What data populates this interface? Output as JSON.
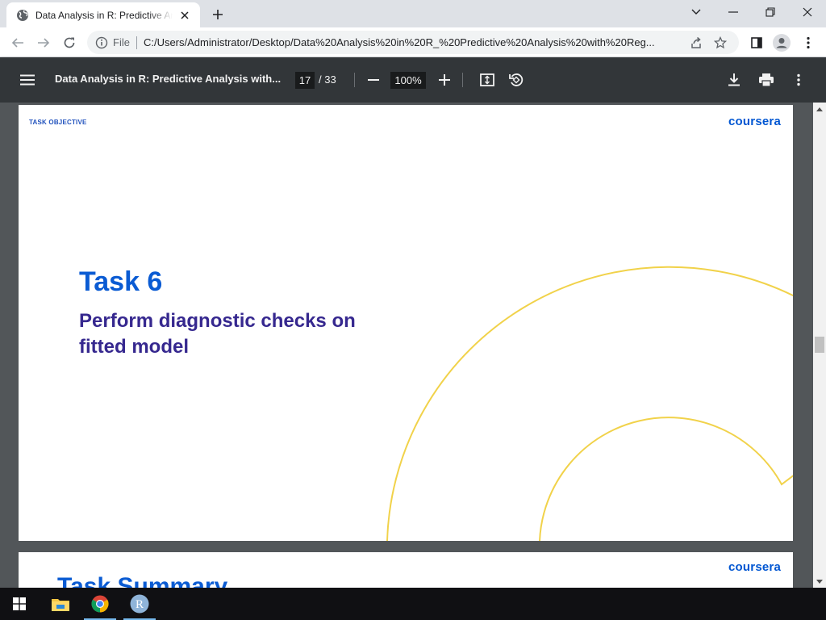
{
  "browser": {
    "tab_title": "Data Analysis in R: Predictive Analysis with Regression",
    "address_scheme": "File",
    "url": "C:/Users/Administrator/Desktop/Data%20Analysis%20in%20R_%20Predictive%20Analysis%20with%20Reg..."
  },
  "pdf_viewer": {
    "title": "Data Analysis in R: Predictive Analysis with...",
    "current_page": "17",
    "total_pages": "/ 33",
    "zoom": "100%"
  },
  "slide": {
    "section_label": "TASK OBJECTIVE",
    "brand": "coursera",
    "heading": "Task 6",
    "subheading": "Perform diagnostic checks on fitted model"
  },
  "next_slide": {
    "brand": "coursera",
    "heading": "Task Summary"
  },
  "colors": {
    "brand_blue": "#0056d2",
    "heading_blue": "#0a5bd3",
    "subheading_purple": "#36288f",
    "arc_yellow": "#f1d24a",
    "viewer_toolbar": "#323639"
  },
  "icons": [
    "globe-icon",
    "close-icon",
    "plus-icon",
    "back-icon",
    "forward-icon",
    "reload-icon",
    "info-icon",
    "share-icon",
    "star-icon",
    "side-panel-icon",
    "profile-icon",
    "kebab-menu-icon",
    "menu-icon",
    "zoom-out-icon",
    "zoom-in-icon",
    "fit-page-icon",
    "rotate-icon",
    "download-icon",
    "print-icon",
    "windows-start-icon",
    "file-explorer-icon",
    "chrome-icon",
    "r-app-icon"
  ]
}
